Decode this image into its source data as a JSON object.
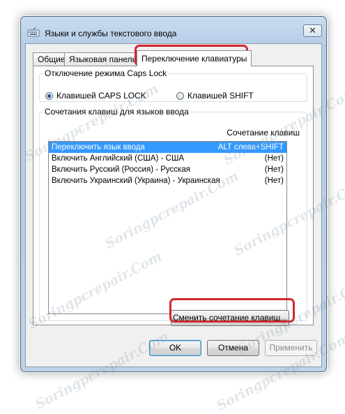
{
  "window": {
    "title": "Языки и службы текстового ввода",
    "close_glyph": "✕"
  },
  "tabs": [
    {
      "label": "Общие"
    },
    {
      "label": "Языковая панель"
    },
    {
      "label": "Переключение клавиатуры",
      "active": true
    }
  ],
  "caps_lock": {
    "legend": "Отключение режима Caps Lock",
    "options": [
      {
        "label": "Клавишей CAPS LOCK",
        "selected": true
      },
      {
        "label": "Клавишей SHIFT",
        "selected": false
      }
    ]
  },
  "hotkeys": {
    "legend": "Сочетания клавиш для языков ввода",
    "column_header": "Сочетание клавиш",
    "rows": [
      {
        "name": "Переключить язык ввода",
        "key": "ALT слева+SHIFT",
        "selected": true
      },
      {
        "name": "Включить Английский (США) - США",
        "key": "(Нет)"
      },
      {
        "name": "Включить Русский (Россия) - Русская",
        "key": "(Нет)"
      },
      {
        "name": "Включить Украинский (Украина) - Украинская",
        "key": "(Нет)"
      }
    ],
    "change_button": "Сменить сочетание клавиш..."
  },
  "footer": {
    "ok": "OK",
    "cancel": "Отмена",
    "apply": "Применить"
  },
  "watermark": "Soringpcrepair.Com",
  "colors": {
    "highlight": "#d0282e",
    "selection": "#3399ff"
  }
}
